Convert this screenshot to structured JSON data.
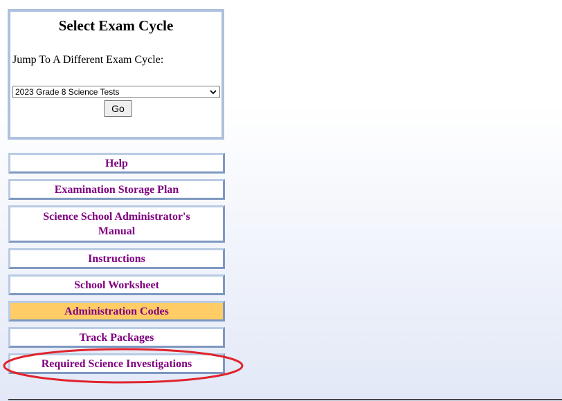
{
  "exam_cycle": {
    "title": "Select Exam Cycle",
    "jump_label": "Jump To A Different Exam Cycle:",
    "selected_cycle": "2023 Grade 8 Science Tests",
    "go_label": "Go"
  },
  "menu": {
    "items": [
      {
        "label": "Help",
        "active": false
      },
      {
        "label": "Examination Storage Plan",
        "active": false
      },
      {
        "label": "Science School Administrator's Manual",
        "active": false
      },
      {
        "label": "Instructions",
        "active": false
      },
      {
        "label": "School Worksheet",
        "active": false
      },
      {
        "label": "Administration Codes",
        "active": true
      },
      {
        "label": "Track Packages",
        "active": false
      },
      {
        "label": "Required Science Investigations",
        "active": false
      }
    ]
  },
  "colors": {
    "link_text": "#800080",
    "active_bg": "#ffcc66",
    "panel_border": "#aec1de",
    "annotation": "#e0242c"
  },
  "annotation": {
    "shape": "red-ellipse",
    "target": "Required Science Investigations"
  }
}
